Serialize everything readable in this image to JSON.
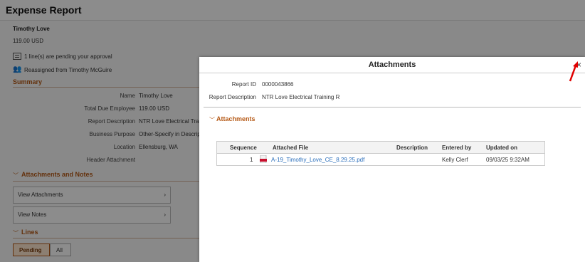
{
  "page": {
    "title": "Expense Report",
    "employee_name": "Timothy Love",
    "amount": "119.00  USD",
    "pending_text": "1 line(s) are pending your approval",
    "reassigned_text": "Reassigned from Timothy McGuire",
    "summary_heading": "Summary",
    "fields": [
      {
        "label": "Name",
        "value": "Timothy Love"
      },
      {
        "label": "Total Due Employee",
        "value": "119.00  USD"
      },
      {
        "label": "Report Description",
        "value": "NTR Love Electrical Tra"
      },
      {
        "label": "Business Purpose",
        "value": "Other-Specify in Descrip"
      },
      {
        "label": "Location",
        "value": "Ellensburg, WA"
      },
      {
        "label": "Header Attachment",
        "value": ""
      }
    ],
    "attachments_notes_heading": "Attachments and Notes",
    "view_attachments_label": "View Attachments",
    "view_notes_label": "View Notes",
    "lines_heading": "Lines",
    "pending_label": "Pending",
    "all_label": "All"
  },
  "modal": {
    "title": "Attachments",
    "report_id_label": "Report ID",
    "report_id_value": "0000043866",
    "report_desc_label": "Report Description",
    "report_desc_value": "NTR Love Electrical Training R",
    "attachments_heading": "Attachments",
    "columns": [
      "Sequence",
      "Attached File",
      "Description",
      "Entered by",
      "Updated on"
    ],
    "rows": [
      {
        "sequence": "1",
        "file": "A-19_Timothy_Love_CE_8.29.25.pdf",
        "description": "",
        "entered_by": "Kelly Clerf",
        "updated_on": "09/03/25  9:32AM"
      }
    ]
  },
  "colors": {
    "accent": "#b65a17",
    "link": "#2a6ebb",
    "arrow": "#e00000"
  },
  "icons": [
    "list-icon",
    "reassign-users-icon",
    "chevron-right-icon",
    "chevron-down-icon",
    "pdf-file-icon",
    "close-icon",
    "red-arrow-icon"
  ]
}
